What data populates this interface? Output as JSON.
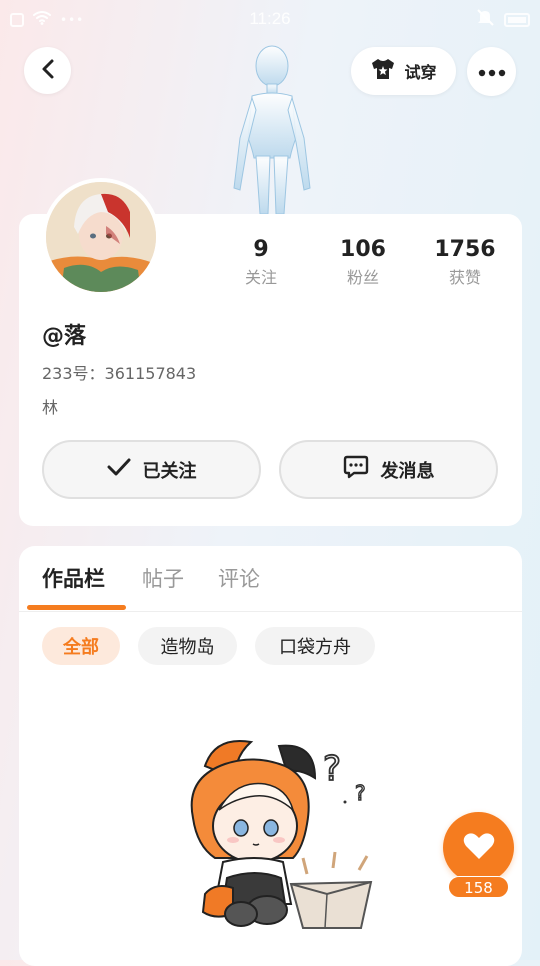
{
  "status_bar": {
    "time": "11:26"
  },
  "header": {
    "tryon_label": "试穿"
  },
  "profile": {
    "stats": [
      {
        "value": "9",
        "label": "关注"
      },
      {
        "value": "106",
        "label": "粉丝"
      },
      {
        "value": "1756",
        "label": "获赞"
      }
    ],
    "username": "@落",
    "id_line": "233号：361157843",
    "bio": "林",
    "follow_label": "已关注",
    "message_label": "发消息"
  },
  "works": {
    "tabs": [
      "作品栏",
      "帖子",
      "评论"
    ],
    "filters": [
      "全部",
      "造物岛",
      "口袋方舟"
    ]
  },
  "like": {
    "count": "158"
  },
  "colors": {
    "accent": "#f57c1f"
  }
}
